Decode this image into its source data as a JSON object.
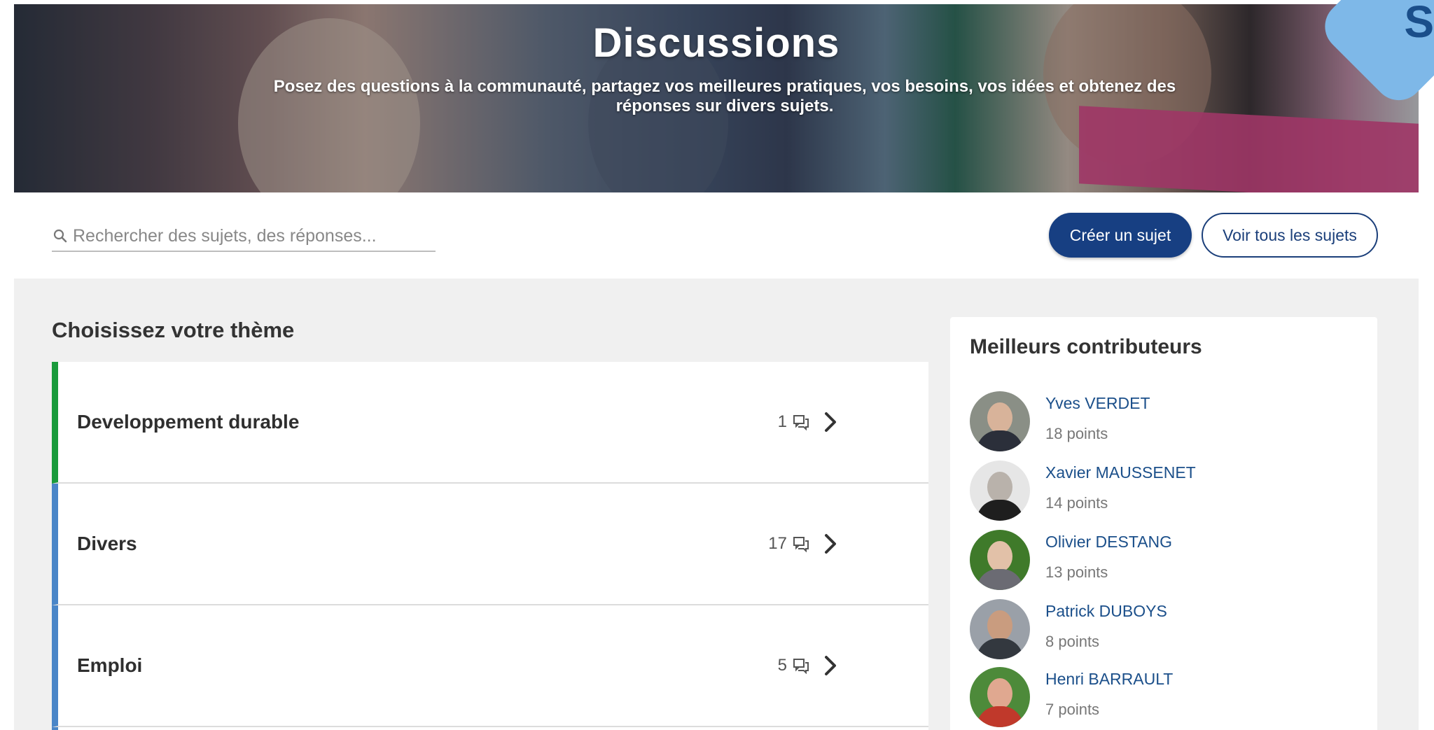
{
  "hero": {
    "title": "Discussions",
    "subtitle_line1": "Posez des questions à la communauté, partagez vos meilleures pratiques, vos besoins, vos idées et obtenez des",
    "subtitle_line2": "réponses sur divers sujets.",
    "corner_letter": "S"
  },
  "search": {
    "placeholder": "Rechercher des sujets, des réponses..."
  },
  "actions": {
    "create_label": "Créer un sujet",
    "view_all_label": "Voir tous les sujets"
  },
  "themes_section": {
    "title": "Choisissez votre thème",
    "items": [
      {
        "name": "Developpement durable",
        "count": "1",
        "accent": "#1a9b3c"
      },
      {
        "name": "Divers",
        "count": "17",
        "accent": "#4a86c8"
      },
      {
        "name": "Emploi",
        "count": "5",
        "accent": "#4a86c8"
      }
    ]
  },
  "contributors": {
    "title": "Meilleurs contributeurs",
    "items": [
      {
        "name": "Yves VERDET",
        "points": "18 points"
      },
      {
        "name": "Xavier MAUSSENET",
        "points": "14 points"
      },
      {
        "name": "Olivier DESTANG",
        "points": "13 points"
      },
      {
        "name": "Patrick DUBOYS",
        "points": "8 points"
      },
      {
        "name": "Henri BARRAULT",
        "points": "7 points"
      }
    ]
  },
  "colors": {
    "primary": "#173f82",
    "link": "#1b4f8a",
    "green_accent": "#1a9b3c",
    "blue_accent": "#4a86c8"
  },
  "icons": {
    "search": "search-icon",
    "comments": "comments-icon",
    "chevron": "chevron-right-icon"
  }
}
